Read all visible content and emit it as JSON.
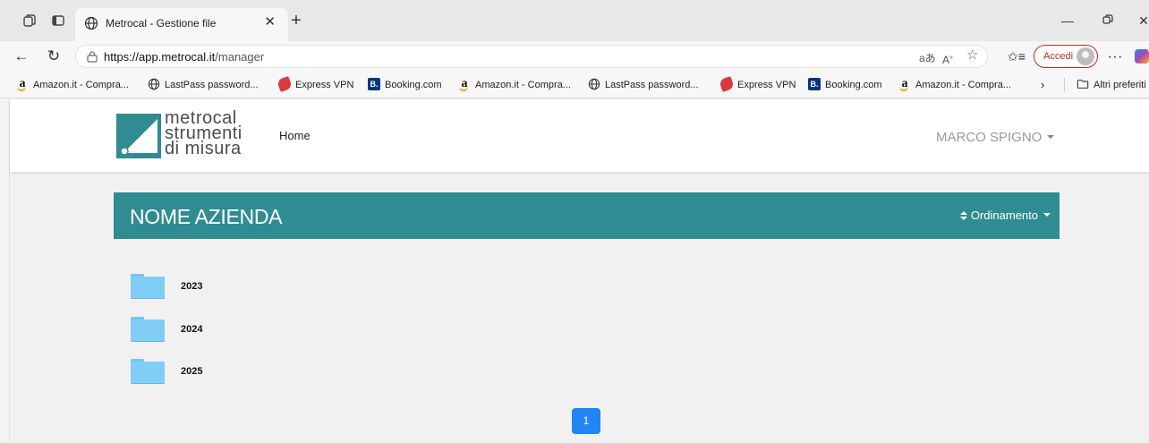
{
  "browser": {
    "tab": {
      "title": "Metrocal - Gestione file"
    },
    "url": {
      "domain": "https://app.metrocal.it",
      "path": "/manager"
    },
    "account_button": "Accedi",
    "bookmarks": [
      {
        "label": "Amazon.it - Compra...",
        "icon": "amazon-icon"
      },
      {
        "label": "LastPass password...",
        "icon": "globe-icon"
      },
      {
        "label": "Express VPN",
        "icon": "expressvpn-icon"
      },
      {
        "label": "Booking.com",
        "icon": "booking-icon"
      },
      {
        "label": "Amazon.it - Compra...",
        "icon": "amazon-icon"
      },
      {
        "label": "LastPass password...",
        "icon": "globe-icon"
      },
      {
        "label": "Express VPN",
        "icon": "expressvpn-icon"
      },
      {
        "label": "Booking.com",
        "icon": "booking-icon"
      },
      {
        "label": "Amazon.it - Compra...",
        "icon": "amazon-icon"
      }
    ],
    "other_favorites": "Altri preferiti"
  },
  "site": {
    "logo_lines": [
      "metrocal",
      "strumenti",
      "di misura"
    ],
    "nav_home": "Home",
    "user_name": "MARCO SPIGNO",
    "company_title": "NOME AZIENDA",
    "sort_label": "Ordinamento",
    "folders": [
      {
        "name": "2023"
      },
      {
        "name": "2024"
      },
      {
        "name": "2025"
      }
    ],
    "pagination": {
      "current_page": "1"
    },
    "colors": {
      "brand_teal": "#2e8c92",
      "folder_blue": "#80cdf5",
      "pager_blue": "#1f86f3"
    }
  }
}
